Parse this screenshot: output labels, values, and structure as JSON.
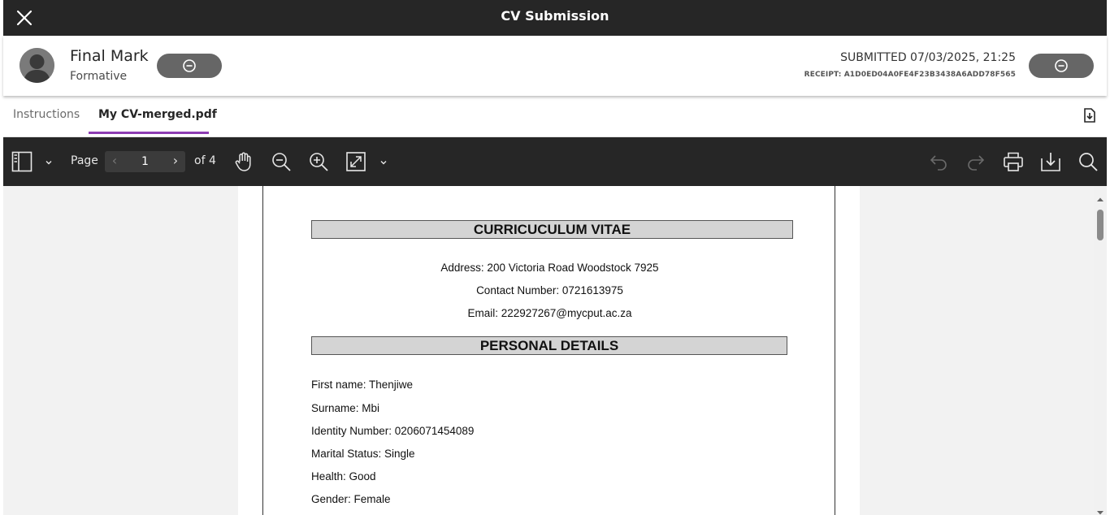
{
  "window": {
    "title": "CV Submission"
  },
  "header": {
    "grade_title": "Final Mark",
    "grade_subtitle": "Formative",
    "submitted": "SUBMITTED 07/03/2025, 21:25",
    "receipt": "RECEIPT: A1D0ED04A0FE4F23B3438A6ADD78F565"
  },
  "tabs": [
    {
      "label": "Instructions",
      "active": false
    },
    {
      "label": "My CV-merged.pdf",
      "active": true
    }
  ],
  "toolbar": {
    "page_label": "Page",
    "current_page": "1",
    "total_pages": "of 4"
  },
  "document": {
    "heading_cv": "CURRICUCULUM VITAE",
    "address": "Address: 200 Victoria Road Woodstock 7925",
    "contact": "Contact Number: 0721613975",
    "email": "Email: 222927267@mycput.ac.za",
    "heading_personal": "PERSONAL DETAILS",
    "details": [
      "First name: Thenjiwe",
      "Surname: Mbi",
      "Identity Number: 0206071454089",
      "Marital Status: Single",
      "Health: Good",
      "Gender: Female"
    ]
  },
  "colors": {
    "titlebar_bg": "#262626",
    "tab_accent": "#8d3cb3",
    "pill_bg": "#666666",
    "viewer_bg": "#f2f2f2"
  },
  "icons": {
    "close": "close-icon",
    "remove": "minus-circle-icon",
    "download_file": "file-download-icon",
    "sidebar": "sidebar-toggle-icon",
    "hand": "hand-pan-icon",
    "zoom_out": "zoom-out-icon",
    "zoom_in": "zoom-in-icon",
    "fit": "fit-page-icon",
    "undo": "undo-icon",
    "redo": "redo-icon",
    "print": "print-icon",
    "download": "download-icon",
    "search": "search-icon"
  }
}
